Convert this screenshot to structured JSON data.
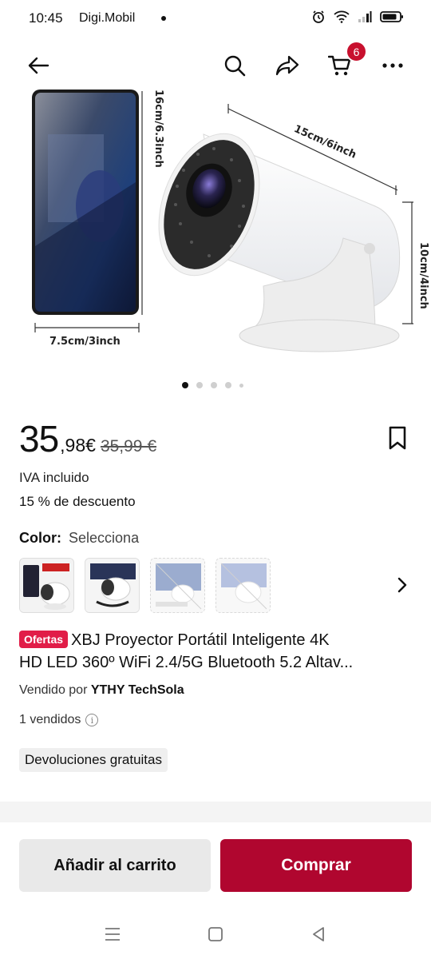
{
  "status_bar": {
    "time": "10:45",
    "carrier": "Digi.Mobil",
    "icons": [
      "alarm-icon",
      "wifi-icon",
      "signal-icon",
      "battery-icon"
    ]
  },
  "nav": {
    "icons": [
      "back-arrow-icon",
      "search-icon",
      "share-icon",
      "cart-icon",
      "more-icon"
    ],
    "cart_count": "6"
  },
  "product_image": {
    "dimensions": {
      "phone_height": "16cm/6.3inch",
      "phone_width": "7.5cm/3inch",
      "projector_length": "15cm/6inch",
      "projector_height": "10cm/4inch"
    },
    "carousel_total": 5,
    "carousel_active": 1
  },
  "price": {
    "integer": "35",
    "decimal": ",98€",
    "original": "35,99 €",
    "tax_note": "IVA incluido",
    "discount": "15 % de descuento"
  },
  "color": {
    "label": "Color:",
    "value": "Selecciona",
    "swatch_count": 4
  },
  "title": {
    "badge": "Ofertas",
    "line1": "XBJ Proyector Portátil Inteligente 4K",
    "line2": "HD LED 360º WiFi 2.4/5G Bluetooth 5.2 Altav..."
  },
  "seller": {
    "prefix": "Vendido por",
    "name": "YTHY TechSola"
  },
  "sold": "1 vendidos",
  "returns": "Devoluciones gratuitas",
  "actions": {
    "add_to_cart": "Añadir al carrito",
    "buy": "Comprar"
  },
  "colors": {
    "accent": "#b0062f",
    "badge": "#e11d48",
    "cart_badge": "#c8102e"
  }
}
